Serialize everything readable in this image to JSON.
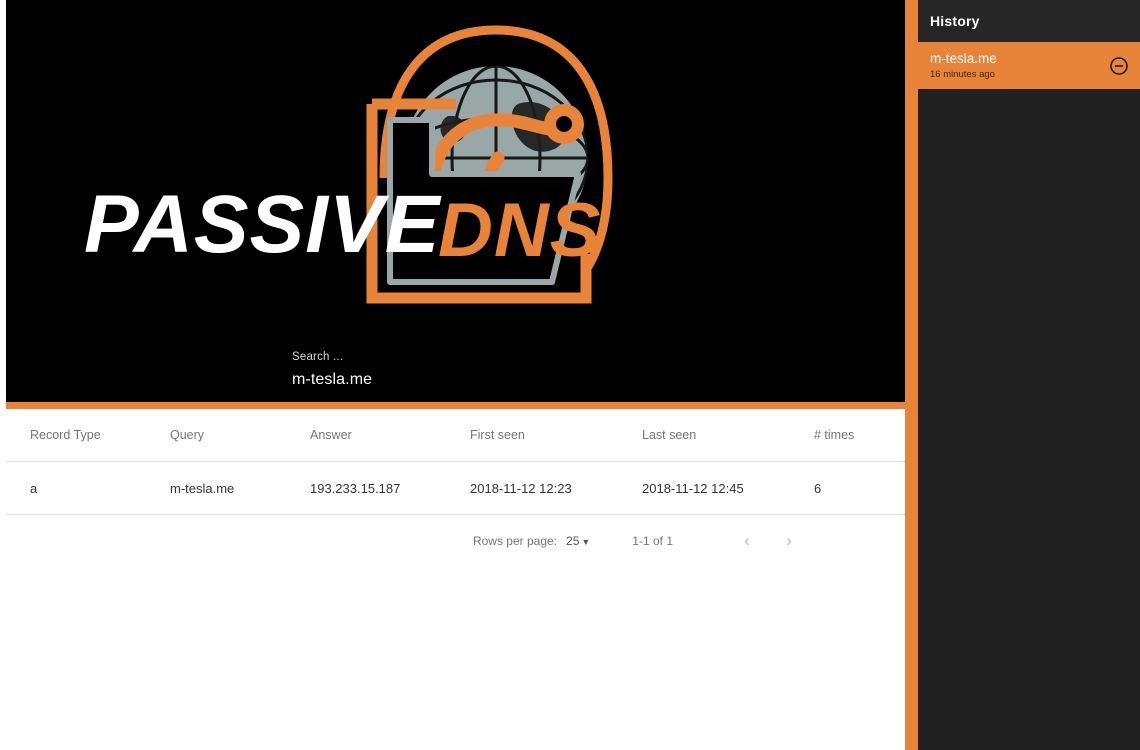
{
  "brand": {
    "name_primary": "PASSIVE",
    "name_secondary": "DNS",
    "accent_color": "#e8833a",
    "globe_color": "#9aa7a8",
    "hero_bg": "#000000"
  },
  "search": {
    "label": "Search ...",
    "value": "m-tesla.me",
    "placeholder": "Search ..."
  },
  "table": {
    "columns": [
      "Record Type",
      "Query",
      "Answer",
      "First seen",
      "Last seen",
      "# times"
    ],
    "rows": [
      {
        "record_type": "a",
        "query": "m-tesla.me",
        "answer": "193.233.15.187",
        "first_seen": "2018-11-12 12:23",
        "last_seen": "2018-11-12 12:45",
        "times": "6"
      }
    ]
  },
  "pagination": {
    "rows_per_page_label": "Rows per page:",
    "rows_per_page_value": "25",
    "caret": "▼",
    "range_label": "1-1 of 1",
    "prev_glyph": "‹",
    "next_glyph": "›"
  },
  "sidebar": {
    "title": "History",
    "items": [
      {
        "query": "m-tesla.me",
        "time_ago": "16 minutes ago"
      }
    ]
  }
}
